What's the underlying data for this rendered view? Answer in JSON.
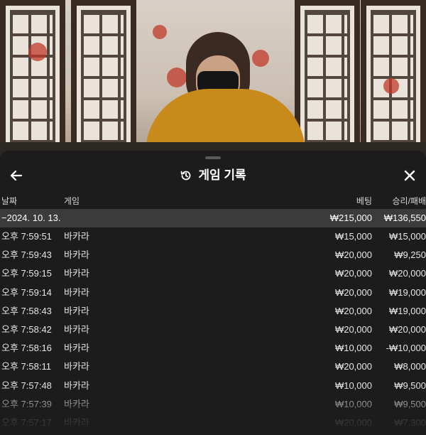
{
  "header": {
    "title": "게임 기록",
    "back_icon": "arrow-left-icon",
    "history_icon": "history-icon",
    "close_icon": "close-icon"
  },
  "columns": {
    "date": "날짜",
    "game": "게임",
    "bet": "베팅",
    "result": "승리/패배"
  },
  "date_group": {
    "label": "−2024. 10. 13.",
    "bet": "₩215,000",
    "result": "₩136,550"
  },
  "rows": [
    {
      "time": "오후 7:59:51",
      "game": "바카라",
      "bet": "₩15,000",
      "result": "₩15,000"
    },
    {
      "time": "오후 7:59:43",
      "game": "바카라",
      "bet": "₩20,000",
      "result": "₩9,250"
    },
    {
      "time": "오후 7:59:15",
      "game": "바카라",
      "bet": "₩20,000",
      "result": "₩20,000"
    },
    {
      "time": "오후 7:59:14",
      "game": "바카라",
      "bet": "₩20,000",
      "result": "₩19,000"
    },
    {
      "time": "오후 7:58:43",
      "game": "바카라",
      "bet": "₩20,000",
      "result": "₩19,000"
    },
    {
      "time": "오후 7:58:42",
      "game": "바카라",
      "bet": "₩20,000",
      "result": "₩20,000"
    },
    {
      "time": "오후 7:58:16",
      "game": "바카라",
      "bet": "₩10,000",
      "result": "-₩10,000"
    },
    {
      "time": "오후 7:58:11",
      "game": "바카라",
      "bet": "₩20,000",
      "result": "₩8,000"
    },
    {
      "time": "오후 7:57:48",
      "game": "바카라",
      "bet": "₩10,000",
      "result": "₩9,500"
    },
    {
      "time": "오후 7:57:39",
      "game": "바카라",
      "bet": "₩10,000",
      "result": "₩9,500"
    },
    {
      "time": "오후 7:57:17",
      "game": "바카라",
      "bet": "₩20,000",
      "result": "₩7,300"
    }
  ],
  "colors": {
    "panel_bg": "#1c1c1c",
    "group_bg": "#3b3b3b",
    "text": "#e6e6e6"
  }
}
